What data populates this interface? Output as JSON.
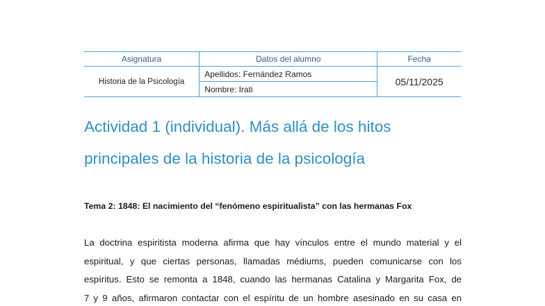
{
  "header": {
    "col_subject": "Asignatura",
    "col_student": "Datos del alumno",
    "col_date": "Fecha",
    "subject": "Historia de la Psicología",
    "surnames": "Apellidos: Fernández Ramos",
    "name": "Nombre: Irati",
    "date": "05/11/2025"
  },
  "title": {
    "line1": "Actividad 1 (individual). Más allá de los hitos",
    "line2": "principales de la historia de la psicología"
  },
  "theme": "Tema 2: 1848: El nacimiento del “fenómeno espiritualista” con las hermanas Fox",
  "body": {
    "lines": [
      "La doctrina espiritista moderna afirma que hay vínculos entre el mundo material y el",
      "espiritual, y que ciertas personas, llamadas médiums, pueden comunicarse con los",
      "espíritus. Esto se remonta a 1848, cuando las hermanas Catalina y Margarita Fox, de",
      "7 y 9 años, afirmaron contactar con el espíritu de un hombre asesinado en su casa en"
    ]
  }
}
